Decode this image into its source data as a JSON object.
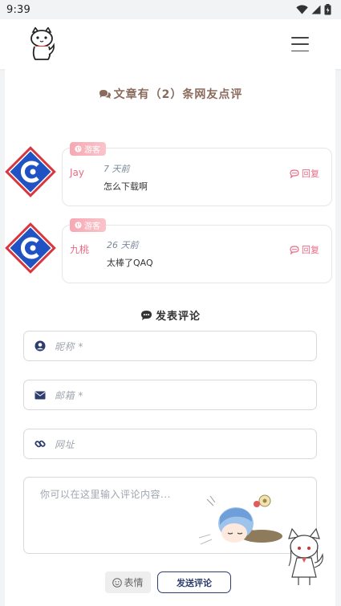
{
  "status_bar": {
    "time": "9:39"
  },
  "header": {
    "logo_icon": "cat-mascot-logo-icon",
    "menu_icon": "hamburger-menu-icon"
  },
  "comments": {
    "title": "文章有（2）条网友点评",
    "items": [
      {
        "badge": "游客",
        "name": "Jay",
        "time": "7 天前",
        "text": "怎么下载啊",
        "reply": "回复"
      },
      {
        "badge": "游客",
        "name": "九桃",
        "time": "26 天前",
        "text": "太棒了QAQ",
        "reply": "回复"
      }
    ]
  },
  "form": {
    "title": "发表评论",
    "nickname_placeholder": "昵称 *",
    "email_placeholder": "邮箱 *",
    "url_placeholder": "网址",
    "content_placeholder": "你可以在这里输入评论内容...",
    "emoji_label": "表情",
    "submit_label": "发送评论"
  },
  "colors": {
    "accent": "#e86a85",
    "title_brown": "#8a6a5c",
    "submit": "#2d3e6e",
    "badge": "#f7a8b3"
  }
}
